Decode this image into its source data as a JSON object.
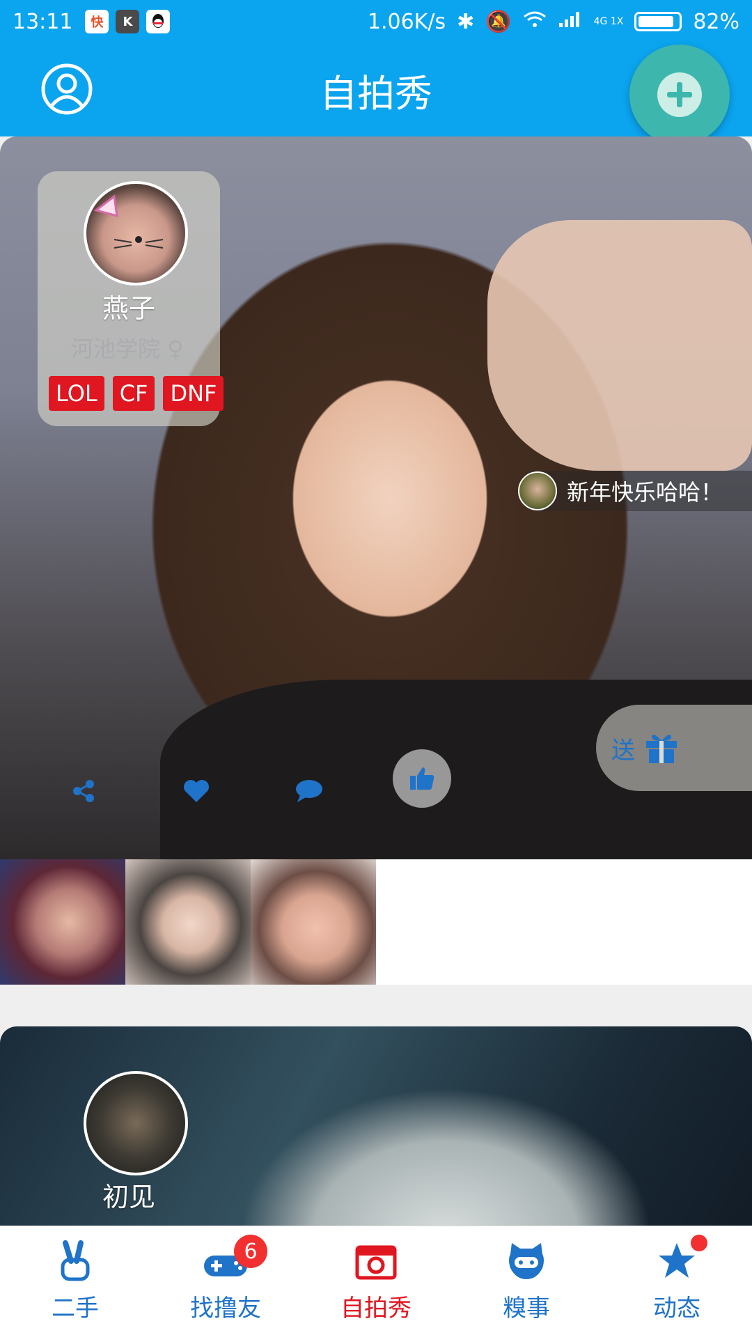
{
  "status_bar": {
    "time": "13:11",
    "speed": "1.06K/s",
    "network": "4G 1X",
    "battery": "82%"
  },
  "header": {
    "title": "自拍秀"
  },
  "post1": {
    "name": "燕子",
    "school": "河池学院",
    "gender_symbol": "♀",
    "tags": [
      "LOL",
      "CF",
      "DNF"
    ],
    "comment": "新年快乐哈哈！",
    "gift_label": "送"
  },
  "post2": {
    "name": "初见"
  },
  "nav": {
    "items": [
      {
        "label": "二手"
      },
      {
        "label": "找撸友",
        "badge": "6"
      },
      {
        "label": "自拍秀"
      },
      {
        "label": "糗事"
      },
      {
        "label": "动态"
      }
    ]
  },
  "colors": {
    "primary": "#0ba4ef",
    "accent": "#e01620",
    "nav_icon": "#1f73c8"
  }
}
